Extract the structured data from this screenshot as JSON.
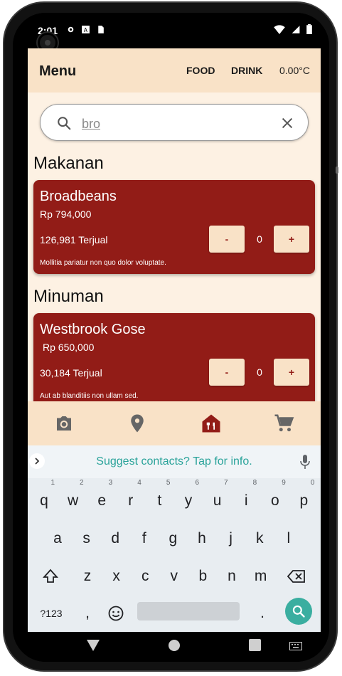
{
  "status_bar": {
    "time": "2:01"
  },
  "app_bar": {
    "title": "Menu",
    "food_label": "FOOD",
    "drink_label": "DRINK",
    "temperature": "0.00°C"
  },
  "search": {
    "value": "bro",
    "placeholder": ""
  },
  "sections": [
    {
      "title": "Makanan",
      "items": [
        {
          "name": "Broadbeans",
          "price": "Rp 794,000",
          "sold": "126,981 Terjual",
          "quantity": "0",
          "minus_label": "-",
          "plus_label": "+",
          "description": "Mollitia pariatur non quo dolor voluptate."
        }
      ]
    },
    {
      "title": "Minuman",
      "items": [
        {
          "name": "Westbrook Gose",
          "price": "Rp 650,000",
          "sold": "30,184 Terjual",
          "quantity": "0",
          "minus_label": "-",
          "plus_label": "+",
          "description": "Aut ab blanditiis non ullam sed."
        }
      ]
    }
  ],
  "bottom_nav": {
    "items": [
      {
        "icon": "camera-icon"
      },
      {
        "icon": "location-pin-icon"
      },
      {
        "icon": "restaurant-icon",
        "active": true
      },
      {
        "icon": "shopping-cart-icon"
      }
    ]
  },
  "keyboard": {
    "suggestion": "Suggest contacts? Tap for info.",
    "row1": [
      {
        "key": "q",
        "hint": "1"
      },
      {
        "key": "w",
        "hint": "2"
      },
      {
        "key": "e",
        "hint": "3"
      },
      {
        "key": "r",
        "hint": "4"
      },
      {
        "key": "t",
        "hint": "5"
      },
      {
        "key": "y",
        "hint": "6"
      },
      {
        "key": "u",
        "hint": "7"
      },
      {
        "key": "i",
        "hint": "8"
      },
      {
        "key": "o",
        "hint": "9"
      },
      {
        "key": "p",
        "hint": "0"
      }
    ],
    "row2": [
      "a",
      "s",
      "d",
      "f",
      "g",
      "h",
      "j",
      "k",
      "l"
    ],
    "row3": [
      "z",
      "x",
      "c",
      "v",
      "b",
      "n",
      "m"
    ],
    "symbols_key": "?123",
    "comma_key": ",",
    "period_key": "."
  },
  "colors": {
    "accent": "#921c17",
    "app_bar": "#f9e2c7",
    "background": "#fdf1e3",
    "keyboard_accent": "#3aaea0"
  }
}
